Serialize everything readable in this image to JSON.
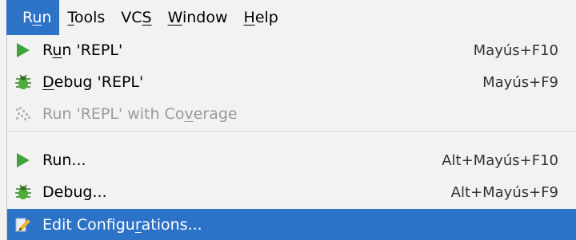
{
  "menubar": {
    "items": [
      {
        "pre": "R",
        "ul": "u",
        "post": "n"
      },
      {
        "pre": "",
        "ul": "T",
        "post": "ools"
      },
      {
        "pre": "VC",
        "ul": "S",
        "post": ""
      },
      {
        "pre": "",
        "ul": "W",
        "post": "indow"
      },
      {
        "pre": "",
        "ul": "H",
        "post": "elp"
      }
    ]
  },
  "run_menu": {
    "items": [
      {
        "pre": "R",
        "ul": "u",
        "post": "n 'REPL'",
        "shortcut": "Mayús+F10",
        "icon": "run-icon",
        "enabled": true
      },
      {
        "pre": "",
        "ul": "D",
        "post": "ebug 'REPL'",
        "shortcut": "Mayús+F9",
        "icon": "debug-icon",
        "enabled": true
      },
      {
        "pre": "Run 'REPL' with Co",
        "ul": "v",
        "post": "erage",
        "shortcut": "",
        "icon": "coverage-icon",
        "enabled": false
      },
      {
        "pre": "Run...",
        "ul": "",
        "post": "",
        "shortcut": "Alt+Mayús+F10",
        "icon": "run-icon",
        "enabled": true
      },
      {
        "pre": "Debug...",
        "ul": "",
        "post": "",
        "shortcut": "Alt+Mayús+F9",
        "icon": "debug-icon",
        "enabled": true
      },
      {
        "pre": "Edit Configu",
        "ul": "r",
        "post": "ations...",
        "shortcut": "",
        "icon": "edit-configurations-icon",
        "enabled": true,
        "selected": true
      }
    ]
  },
  "colors": {
    "accent": "#2c72c7",
    "run_green": "#3ea43a",
    "disabled_text": "#9a9a9a",
    "background": "#f2f2f2"
  }
}
